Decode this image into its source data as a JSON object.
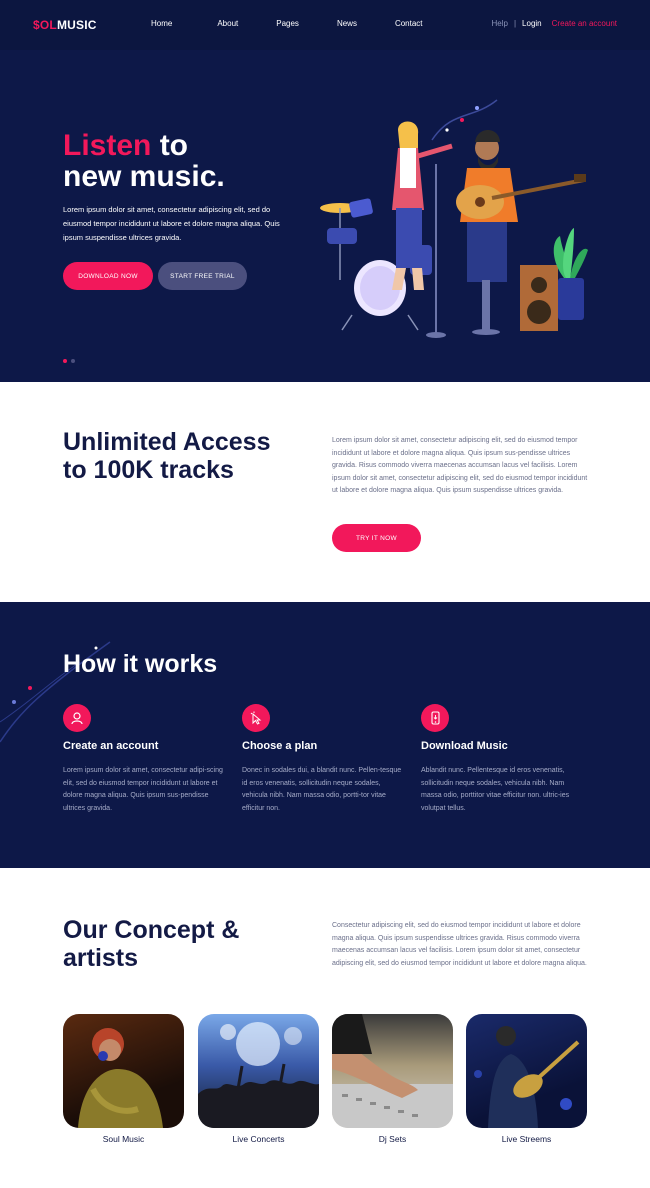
{
  "nav": {
    "logo_accent": "$OL",
    "logo_rest": "MUSIC",
    "menu": [
      "Home",
      "About",
      "Pages",
      "News",
      "Contact"
    ],
    "help": "Help",
    "separator": "|",
    "login": "Login",
    "create_account": "Create an account"
  },
  "hero": {
    "title_accent": "Listen",
    "title_rest_1": " to",
    "title_line_2": "new music.",
    "body": "Lorem ipsum dolor sit amet, consectetur adipiscing elit, sed do eiusmod tempor incididunt ut labore et dolore magna aliqua. Quis ipsum suspendisse ultrices gravida.",
    "download_button": "DOWNLOAD NOW",
    "trial_button": "START FREE TRIAL"
  },
  "access": {
    "title_line_1": "Unlimited Access",
    "title_line_2": "to 100K tracks",
    "body": "Lorem ipsum dolor sit amet, consectetur adipiscing elit, sed do eiusmod tempor incididunt ut labore et dolore magna aliqua. Quis ipsum sus-pendisse ultrices gravida. Risus commodo viverra maecenas accumsan lacus vel facilisis. Lorem ipsum dolor sit amet, consectetur adipiscing elit, sed do eiusmod tempor incididunt ut labore et dolore magna aliqua. Quis ipsum suspendisse ultrices gravida.",
    "button": "TRY IT NOW"
  },
  "how": {
    "title": "How it works",
    "steps": [
      {
        "title": "Create an account",
        "text": "Lorem ipsum dolor sit amet, consectetur adipi-scing elit, sed do eiusmod tempor incididunt ut labore et dolore magna aliqua. Quis ipsum sus-pendisse ultrices gravida.",
        "icon": "user-icon"
      },
      {
        "title": "Choose a plan",
        "text": "Donec in sodales dui, a blandit nunc. Pellen-tesque id eros venenatis, sollicitudin neque sodales, vehicula nibh. Nam massa odio, portti-tor vitae efficitur non.",
        "icon": "cursor-icon"
      },
      {
        "title": "Download Music",
        "text": "Ablandit nunc. Pellentesque id eros venenatis, sollicitudin neque sodales, vehicula nibh. Nam massa odio, porttitor vitae efficitur non. ultric-ies volutpat tellus.",
        "icon": "phone-icon"
      }
    ]
  },
  "concept": {
    "title_line_1": "Our Concept &",
    "title_line_2": "artists",
    "body": "Consectetur adipiscing elit, sed do eiusmod tempor incididunt ut labore et dolore magna aliqua. Quis ipsum suspendisse ultrices gravida. Risus commodo viverra maecenas accumsan lacus vel facilisis. Lorem ipsum dolor sit amet, consectetur adipiscing elit, sed do eiusmod tempor incididunt ut labore et dolore magna aliqua.",
    "cards": [
      "Soul Music",
      "Live Concerts",
      "Dj Sets",
      "Live Streems"
    ]
  },
  "colors": {
    "navy": "#0d1848",
    "pink": "#f2185b",
    "heading": "#131a45"
  }
}
